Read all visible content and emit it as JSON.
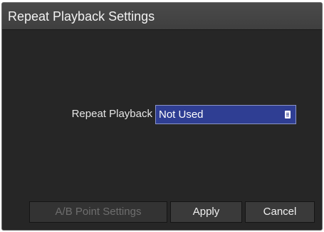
{
  "dialog": {
    "title": "Repeat Playback Settings",
    "repeat_playback": {
      "label": "Repeat Playback",
      "selected_value": "Not Used",
      "icon": "list-icon"
    },
    "buttons": {
      "ab_point": {
        "label": "A/B Point Settings",
        "enabled": false
      },
      "apply": {
        "label": "Apply",
        "enabled": true
      },
      "cancel": {
        "label": "Cancel",
        "enabled": true
      }
    }
  },
  "colors": {
    "background": "#262626",
    "titlebar": "#444444",
    "select_background": "#2f3e93",
    "text": "#e6e6e6",
    "disabled_text": "#6e6e6e"
  }
}
